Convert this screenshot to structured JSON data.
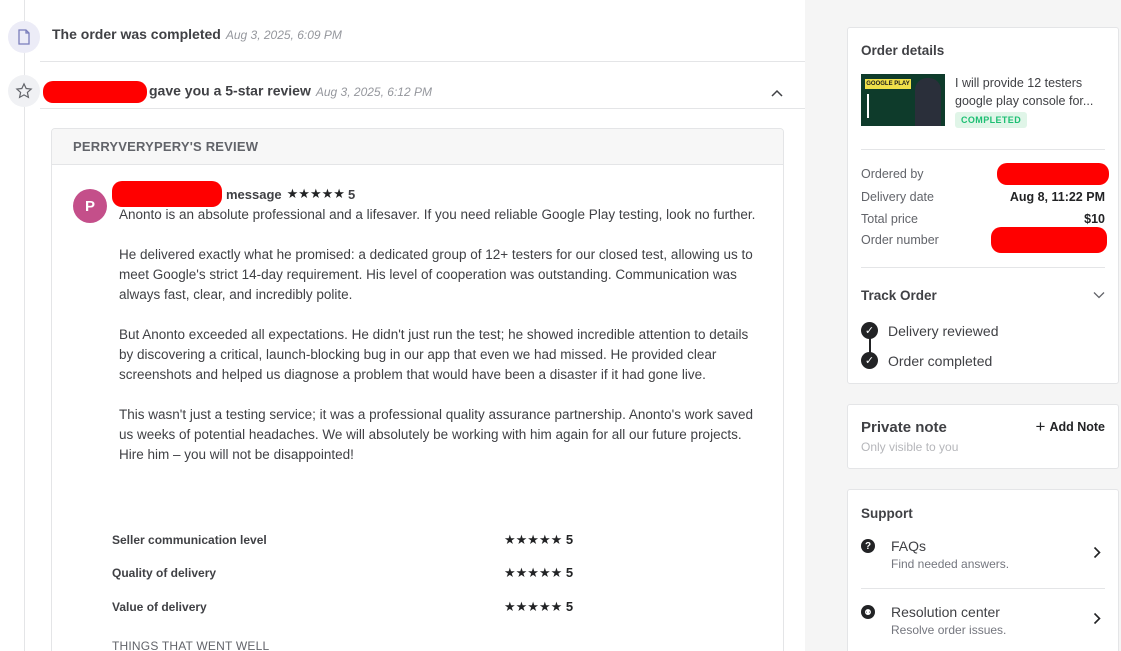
{
  "timeline": {
    "events": [
      {
        "text": "The order was completed",
        "date": "Aug 3, 2025, 6:09 PM",
        "icon": "document-icon"
      },
      {
        "text": "gave you a 5-star review",
        "date": "Aug 3, 2025, 6:12 PM",
        "icon": "star-icon"
      }
    ]
  },
  "review": {
    "header": "PERRYVERYPERY'S REVIEW",
    "avatar_initial": "P",
    "meta_label": "message",
    "overall_rating": "5",
    "stars": "★★★★★",
    "paragraphs": [
      "Anonto is an absolute professional and a lifesaver. If you need reliable Google Play testing, look no further.",
      "He delivered exactly what he promised: a dedicated group of 12+ testers for our closed test, allowing us to meet Google's strict 14-day requirement. His level of cooperation was outstanding. Communication was always fast, clear, and incredibly polite.",
      "But Anonto exceeded all expectations. He didn't just run the test; he showed incredible attention to details by discovering a critical, launch-blocking bug in our app that even we had missed. He provided clear screenshots and helped us diagnose a problem that would have been a disaster if it had gone live.",
      "This wasn't just a testing service; it was a professional quality assurance partnership. Anonto's work saved us weeks of potential headaches. We will absolutely be working with him again for all our future projects. Hire him – you will not be disappointed!"
    ],
    "ratings": [
      {
        "label": "Seller communication level",
        "value": "5"
      },
      {
        "label": "Quality of delivery",
        "value": "5"
      },
      {
        "label": "Value of delivery",
        "value": "5"
      }
    ],
    "went_well": "THINGS THAT WENT WELL"
  },
  "order_details": {
    "title": "Order details",
    "gig_title": "I will provide 12 testers google play console for...",
    "status": "COMPLETED",
    "thumb_text": "GOOGLE PLAY",
    "ordered_by_label": "Ordered by",
    "delivery_date_label": "Delivery date",
    "delivery_date": "Aug 8, 11:22 PM",
    "total_price_label": "Total price",
    "total_price": "$10",
    "order_number_label": "Order number"
  },
  "track_order": {
    "title": "Track Order",
    "steps": [
      "Delivery reviewed",
      "Order completed"
    ]
  },
  "private_note": {
    "title": "Private note",
    "subtitle": "Only visible to you",
    "add_label": "Add Note"
  },
  "support": {
    "title": "Support",
    "items": [
      {
        "title": "FAQs",
        "subtitle": "Find needed answers."
      },
      {
        "title": "Resolution center",
        "subtitle": "Resolve order issues."
      }
    ]
  },
  "colors": {
    "redaction": "#ff0000",
    "avatar": "#c44f8a",
    "completed_badge": "#1dbf73"
  }
}
